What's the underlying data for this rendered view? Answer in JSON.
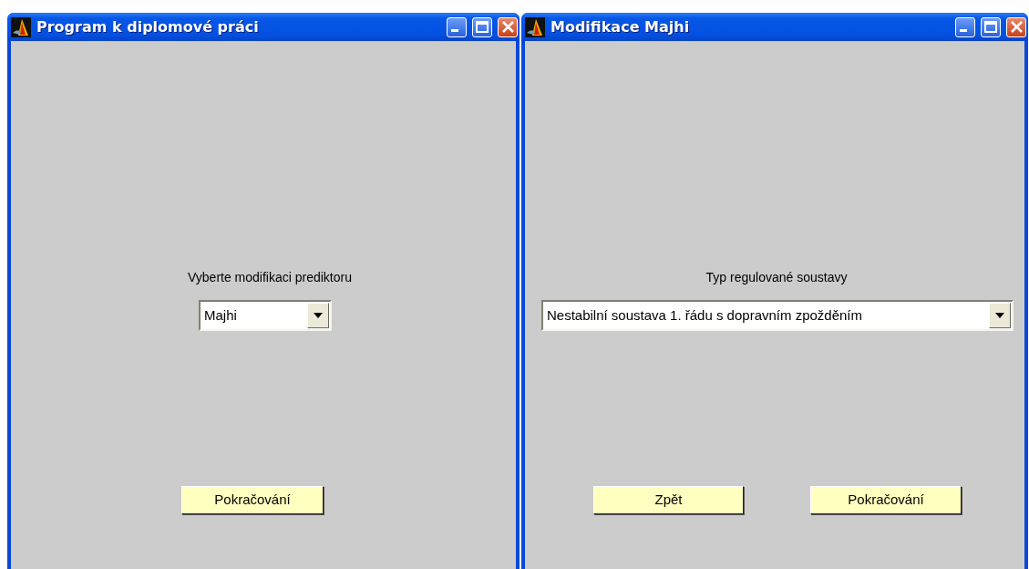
{
  "windows": [
    {
      "title": "Program k diplomové práci",
      "label": "Vyberte modifikaci prediktoru",
      "dropdown": {
        "value": "Majhi"
      },
      "buttons": [
        "Pokračování"
      ]
    },
    {
      "title": "Modifikace Majhi",
      "label": "Typ regulované soustavy",
      "dropdown": {
        "value": "Nestabilní soustava 1. řádu s dopravním zpožděním"
      },
      "buttons": [
        "Zpět",
        "Pokračování"
      ]
    }
  ]
}
